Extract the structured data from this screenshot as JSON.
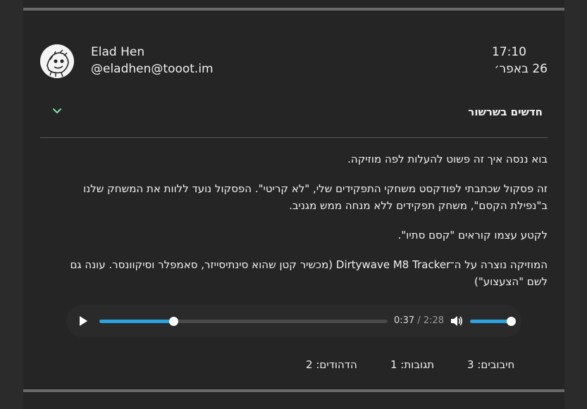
{
  "post": {
    "author_name": "Elad Hen",
    "author_handle": "@eladhen@tooot.im",
    "time": "17:10",
    "date": "26 באפר׳",
    "thread_label": "חדשים בשרשור",
    "paragraphs": [
      "בוא ננסה איך זה פשוט להעלות לפה מוזיקה.",
      "זה פסקול שכתבתי לפודקסט משחקי התפקידים שלי, \"לא קריטי\". הפסקול נועד ללוות את המשחק שלנו ב\"נפילת הקסם\", משחק תפקידים ללא מנחה ממש מגניב.",
      "לקטע עצמו קוראים \"קסם סתיו\".",
      "המוזיקה נוצרה על ה־Dirtywave M8 Tracker (מכשיר קטן שהוא סינתיסייזר, סאמפלר וסיקוונסר. עונה גם לשם \"הצעצוע\")"
    ]
  },
  "player": {
    "current_time": "0:37",
    "separator": "/",
    "duration": "2:28",
    "progress": 0.257,
    "volume": 1.0,
    "accent_color": "#2aa3e0",
    "icons": {
      "play": "play-icon",
      "volume": "speaker-icon"
    }
  },
  "stats": {
    "favourites_label": "חיבובים:",
    "favourites_count": "3",
    "replies_label": "תגובות:",
    "replies_count": "1",
    "boosts_label": "הדהודים:",
    "boosts_count": "2"
  },
  "colors": {
    "accent_chevron": "#7ee0a0"
  }
}
